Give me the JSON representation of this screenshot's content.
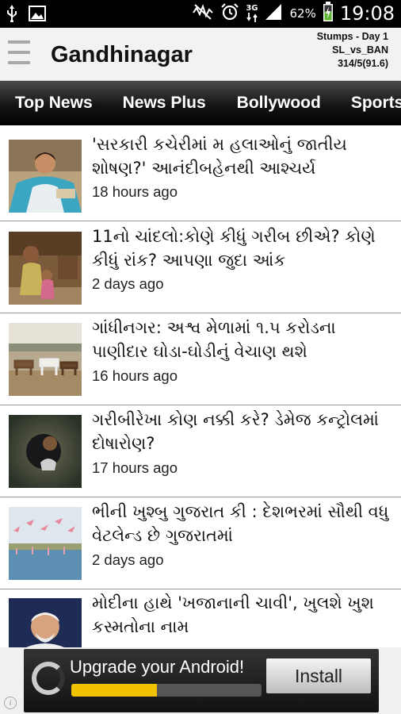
{
  "status_bar": {
    "left_icons": [
      "usb-icon",
      "image-icon"
    ],
    "right_icons": [
      "mute-icon",
      "alarm-icon",
      "3g-icon",
      "signal-icon",
      "battery-icon"
    ],
    "network_label": "3G",
    "battery_percent": "62%",
    "time": "19:08"
  },
  "header": {
    "title": "Gandhinagar",
    "score": {
      "line1": "Stumps - Day 1",
      "line2": "SL_vs_BAN",
      "line3": "314/5(91.6)"
    }
  },
  "tabs": [
    {
      "label": "Top News"
    },
    {
      "label": "News Plus"
    },
    {
      "label": "Bollywood"
    },
    {
      "label": "Sports"
    }
  ],
  "news": [
    {
      "title": "'સરકારી કચેરીમાં મ   હલાઓનું જાતીય શોષણ?' આનંદીબહેનથી આશ્ચર્ય",
      "time": "18 hours ago"
    },
    {
      "title": "11નો ચાંદલો:કોણે કીધું ગરીબ છીએ? કોણે કીધું રાંક? આપણા જુદા આંક",
      "time": "2 days ago"
    },
    {
      "title": "ગાંધીનગર: અશ્વ મેળામાં ૧.૫ કરોડના પાણીદાર ઘોડા-ઘોડીનું વેચાણ થશે",
      "time": "16 hours ago"
    },
    {
      "title": "ગરીબીરેખા કોણ નક્કી કરે? ડેમેજ કન્ટ્રોલમાં દોષારોણ?",
      "time": "17 hours ago"
    },
    {
      "title": "ભીની ખુશ્બુ ગુજરાત કી : દેશભરમાં સૌથી વધુ વેટલેન્ડ છે ગુજરાતમાં",
      "time": "2 days ago"
    },
    {
      "title": "મોદીના હાથે 'ખજાનાની ચાવી', ખુલશે ખુશ   કસ્મતોના નામ",
      "time": ""
    }
  ],
  "ad": {
    "text": "Upgrade your Android!",
    "button": "Install",
    "progress": 0.45,
    "colors": {
      "bar": "#f2c200"
    }
  }
}
